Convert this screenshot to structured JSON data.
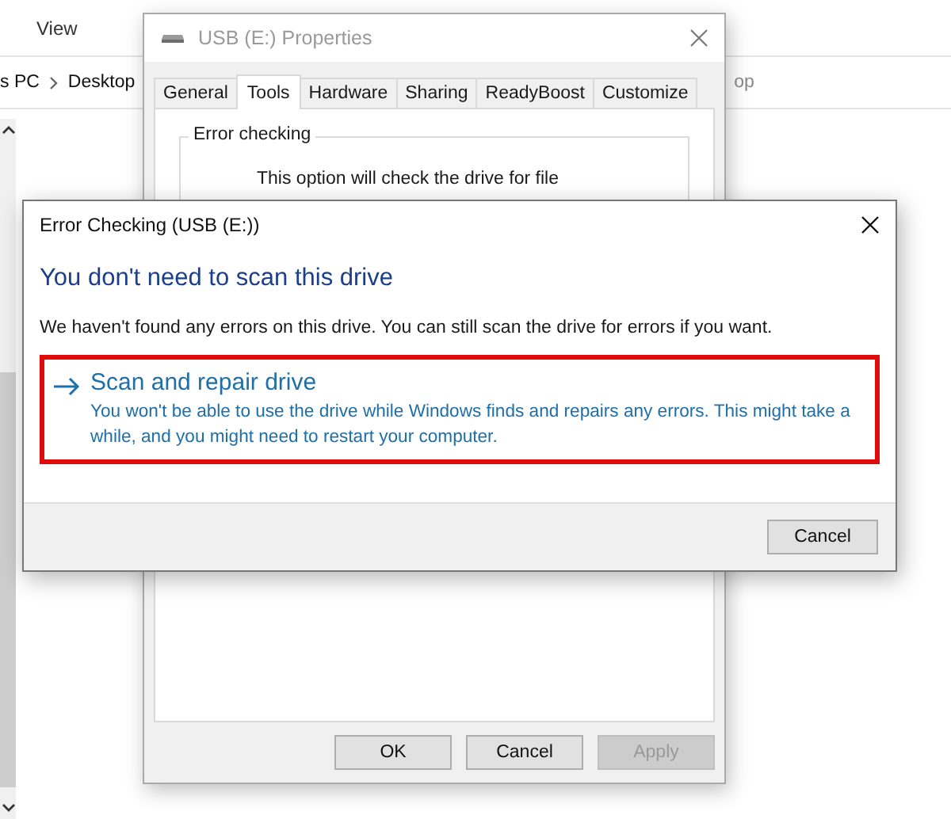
{
  "explorer": {
    "menu": [
      "View"
    ],
    "breadcrumb": [
      "s PC",
      "Desktop"
    ],
    "path_tail": "op"
  },
  "properties_window": {
    "title": "USB (E:) Properties",
    "active": false,
    "tabs": [
      {
        "label": "General",
        "selected": false
      },
      {
        "label": "Tools",
        "selected": true
      },
      {
        "label": "Hardware",
        "selected": false
      },
      {
        "label": "Sharing",
        "selected": false
      },
      {
        "label": "ReadyBoost",
        "selected": false
      },
      {
        "label": "Customize",
        "selected": false
      }
    ],
    "group_title": "Error checking",
    "description": "This option will check the drive for file",
    "buttons": [
      {
        "label": "OK",
        "disabled": false
      },
      {
        "label": "Cancel",
        "disabled": false
      },
      {
        "label": "Apply",
        "disabled": true
      }
    ]
  },
  "error_dialog": {
    "title": "Error Checking (USB (E:))",
    "active": true,
    "heading": "You don't need to scan this drive",
    "message": "We haven't found any errors on this drive. You can still scan the drive for errors if you want.",
    "option": {
      "title": "Scan and repair drive",
      "description": "You won't be able to use the drive while Windows finds and repairs any errors. This might take a while, and you might need to restart your computer.",
      "highlighted": true
    },
    "buttons": [
      {
        "label": "Cancel",
        "disabled": false
      }
    ]
  }
}
